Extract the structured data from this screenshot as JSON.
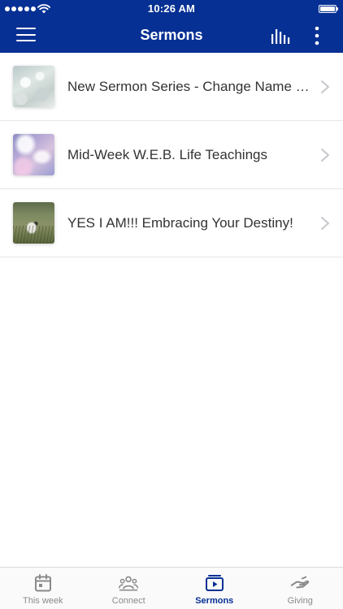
{
  "status_bar": {
    "time": "10:26 AM"
  },
  "header": {
    "title": "Sermons",
    "background_color": "#063093"
  },
  "sermons": [
    {
      "title": "New Sermon Series - Change Name h...",
      "thumbnail": "snowy-landscape"
    },
    {
      "title": "Mid-Week W.E.B. Life Teachings",
      "thumbnail": "purple-clouds"
    },
    {
      "title": "YES I AM!!! Embracing Your Destiny!",
      "thumbnail": "lamb-in-field"
    }
  ],
  "tabs": [
    {
      "label": "This week",
      "icon": "calendar-icon",
      "active": false
    },
    {
      "label": "Connect",
      "icon": "people-icon",
      "active": false
    },
    {
      "label": "Sermons",
      "icon": "play-media-icon",
      "active": true
    },
    {
      "label": "Giving",
      "icon": "giving-hand-icon",
      "active": false
    }
  ],
  "colors": {
    "accent": "#063093",
    "inactive_tab": "#8a8a8a"
  }
}
